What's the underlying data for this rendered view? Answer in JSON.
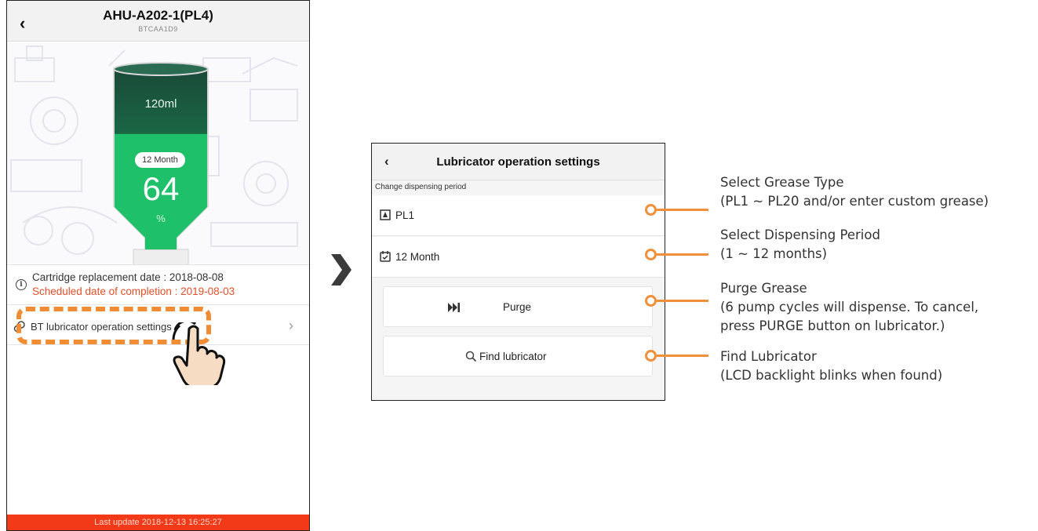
{
  "left_phone": {
    "title": "AHU-A202-1(PL4)",
    "device_id": "BTCAA1D9",
    "back_glyph": "‹",
    "cartridge": {
      "volume": "120ml",
      "period": "12 Month",
      "percent": "64",
      "percent_unit": "%",
      "level_fraction": 0.64,
      "fill_color": "#1fc06a"
    },
    "info": {
      "replacement": "Cartridge replacement date : 2018-08-08",
      "completion": "Scheduled date of completion : 2019-08-03"
    },
    "settings_label": "BT lubricator operation settings",
    "settings_icon": "link-icon",
    "chevron": "›",
    "footer": "Last update 2018-12-13 16:25:27"
  },
  "right_phone": {
    "title": "Lubricator operation settings",
    "back_glyph": "‹",
    "section_label": "Change dispensing period",
    "rows": [
      {
        "label": "PL1",
        "icon": "grease-cartridge-icon"
      },
      {
        "label": "12 Month",
        "icon": "calendar-icon"
      }
    ],
    "buttons": [
      {
        "label": "Purge",
        "icon": "fast-forward-icon"
      },
      {
        "label": "Find lubricator",
        "icon": "search-icon"
      }
    ]
  },
  "annotations": [
    {
      "title": "Select Grease Type",
      "lines": [
        "(PL1 ~ PL20 and/or enter custom grease)"
      ]
    },
    {
      "title": "Select Dispensing Period",
      "lines": [
        "(1 ~ 12 months)"
      ]
    },
    {
      "title": "Purge Grease",
      "lines": [
        "(6 pump cycles will dispense. To cancel,",
        "press PURGE button on lubricator.)"
      ]
    },
    {
      "title": "Find Lubricator",
      "lines": [
        "(LCD backlight blinks when found)"
      ]
    }
  ],
  "colors": {
    "accent_orange": "#f0903a",
    "footer_red": "#f23a18",
    "alert_text": "#e2502b",
    "tank_green": "#1fc06a"
  }
}
